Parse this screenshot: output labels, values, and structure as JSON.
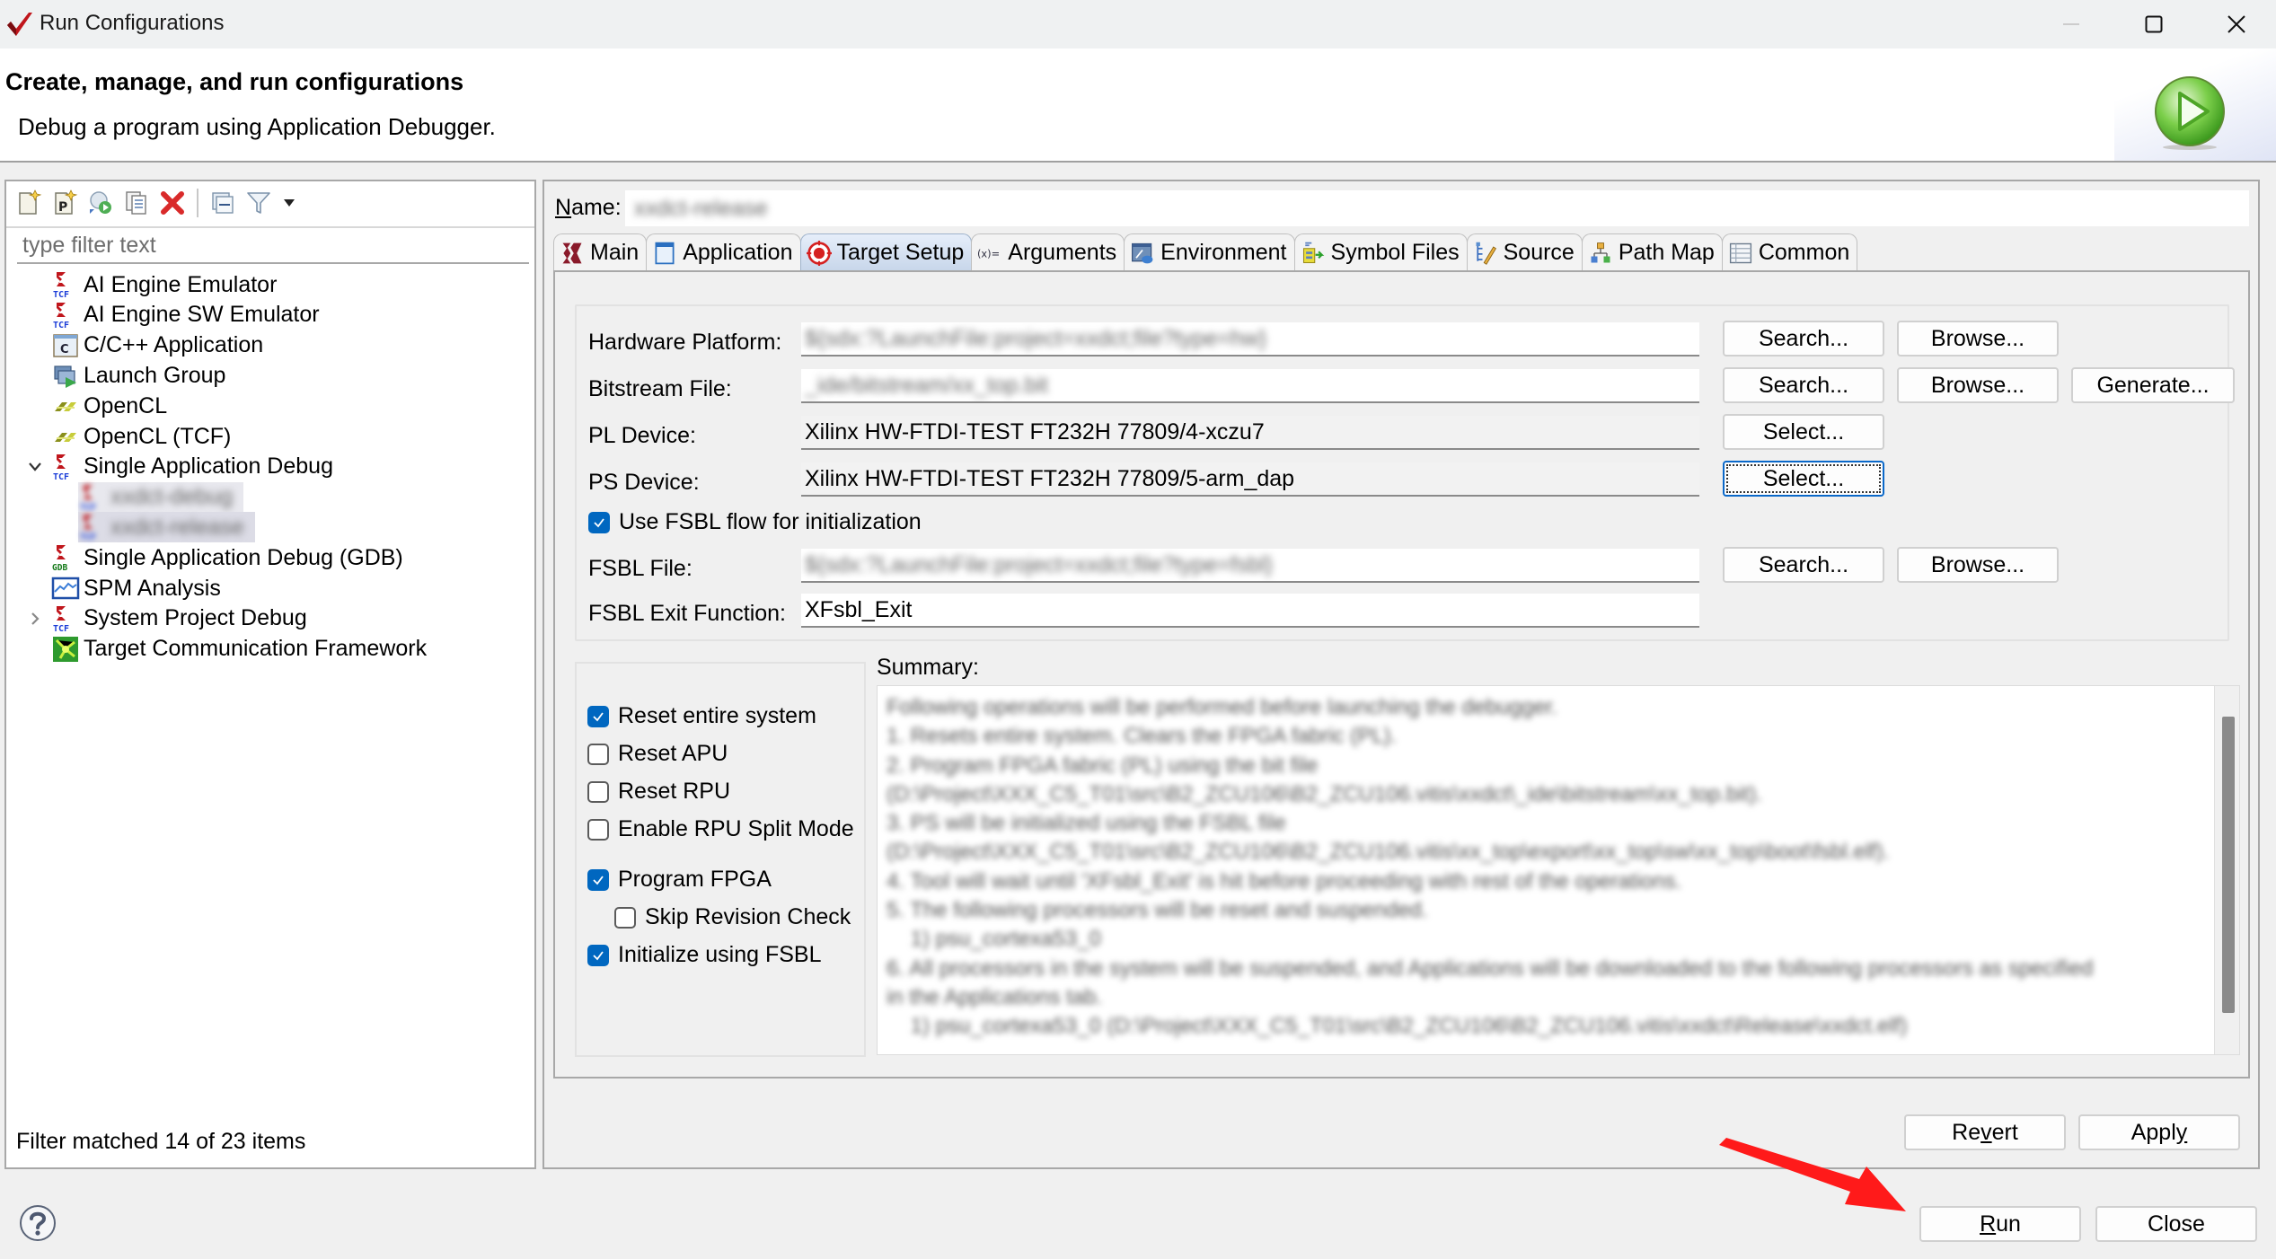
{
  "window": {
    "title": "Run Configurations",
    "controls": {
      "minimize": "minimize",
      "maximize": "maximize",
      "close": "close"
    }
  },
  "header": {
    "heading": "Create, manage, and run configurations",
    "description": "Debug a program using Application Debugger."
  },
  "left_panel": {
    "toolbar": [
      "new-configuration",
      "new-prototype",
      "export",
      "duplicate",
      "delete",
      "collapse-all",
      "filter",
      "view-menu"
    ],
    "filter_placeholder": "type filter text",
    "filter_value": "",
    "tree": [
      {
        "label": "AI Engine Emulator",
        "icon": "xilinx-tcf-icon",
        "expand": "none"
      },
      {
        "label": "AI Engine SW Emulator",
        "icon": "xilinx-tcf-icon",
        "expand": "none"
      },
      {
        "label": "C/C++ Application",
        "icon": "c-app-icon",
        "expand": "none"
      },
      {
        "label": "Launch Group",
        "icon": "launch-group-icon",
        "expand": "none"
      },
      {
        "label": "OpenCL",
        "icon": "opencl-icon",
        "expand": "none"
      },
      {
        "label": "OpenCL (TCF)",
        "icon": "opencl-icon",
        "expand": "none"
      },
      {
        "label": "Single Application Debug",
        "icon": "xilinx-tcf-icon",
        "expand": "expanded"
      },
      {
        "label": "xxdct-debug",
        "icon": "xilinx-tcf-icon",
        "expand": "child",
        "redacted": true
      },
      {
        "label": "xxdct-release",
        "icon": "xilinx-tcf-icon",
        "expand": "child",
        "redacted": true,
        "selected": true
      },
      {
        "label": "Single Application Debug (GDB)",
        "icon": "xilinx-gdb-icon",
        "expand": "none"
      },
      {
        "label": "SPM Analysis",
        "icon": "spm-icon",
        "expand": "none"
      },
      {
        "label": "System Project Debug",
        "icon": "xilinx-tcf-icon",
        "expand": "collapsed"
      },
      {
        "label": "Target Communication Framework",
        "icon": "tcf-icon",
        "expand": "none"
      }
    ],
    "status": "Filter matched 14 of 23 items"
  },
  "config": {
    "name_label": "Name:",
    "name_value": "xxdct-release",
    "tabs": [
      {
        "label": "Main",
        "icon": "xilinx-icon",
        "active": false
      },
      {
        "label": "Application",
        "icon": "application-icon",
        "active": false
      },
      {
        "label": "Target Setup",
        "icon": "target-icon",
        "active": true
      },
      {
        "label": "Arguments",
        "icon": "arguments-icon",
        "active": false
      },
      {
        "label": "Environment",
        "icon": "environment-icon",
        "active": false
      },
      {
        "label": "Symbol Files",
        "icon": "symbol-files-icon",
        "active": false
      },
      {
        "label": "Source",
        "icon": "source-icon",
        "active": false
      },
      {
        "label": "Path Map",
        "icon": "path-map-icon",
        "active": false
      },
      {
        "label": "Common",
        "icon": "common-icon",
        "active": false
      }
    ],
    "target_setup": {
      "hardware_platform": {
        "label": "Hardware Platform:",
        "value": "${sdx:?LaunchFile:project=xxdct;file?type=hw}",
        "redacted": true
      },
      "bitstream_file": {
        "label": "Bitstream File:",
        "value": "_ide/bitstream/xx_top.bit",
        "redacted": true
      },
      "pl_device": {
        "label": "PL Device:",
        "value": "Xilinx HW-FTDI-TEST FT232H 77809/4-xczu7"
      },
      "ps_device": {
        "label": "PS Device:",
        "value": "Xilinx HW-FTDI-TEST FT232H 77809/5-arm_dap"
      },
      "use_fsbl_flow": {
        "label": "Use FSBL flow for initialization",
        "checked": true
      },
      "fsbl_file": {
        "label": "FSBL File:",
        "value": "${sdx:?LaunchFile:project=xxdct;file?type=fsbl}",
        "redacted": true
      },
      "fsbl_exit_function": {
        "label": "FSBL Exit Function:",
        "value": "XFsbl_Exit"
      },
      "buttons": {
        "search": "Search...",
        "browse": "Browse...",
        "generate": "Generate...",
        "select": "Select..."
      }
    },
    "options": [
      {
        "label": "Reset entire system",
        "checked": true,
        "indent": false
      },
      {
        "label": "Reset APU",
        "checked": false,
        "indent": false
      },
      {
        "label": "Reset RPU",
        "checked": false,
        "indent": false
      },
      {
        "label": "Enable RPU Split Mode",
        "checked": false,
        "indent": false
      },
      {
        "label": "Program FPGA",
        "checked": true,
        "indent": false
      },
      {
        "label": "Skip Revision Check",
        "checked": false,
        "indent": true
      },
      {
        "label": "Initialize using FSBL",
        "checked": true,
        "indent": false
      }
    ],
    "summary_label": "Summary:",
    "summary_lines": [
      "Following operations will be performed before launching the debugger.",
      "1. Resets entire system. Clears the FPGA fabric (PL).",
      "2. Program FPGA fabric (PL) using the bit file",
      "(D:\\Project\\XXX_C5_T01\\src\\B2_ZCU106\\B2_ZCU106.vitis\\xxdct\\_ide\\bitstream\\xx_top.bit).",
      "3. PS will be initialized using the FSBL file",
      "(D:\\Project\\XXX_C5_T01\\src\\B2_ZCU106\\B2_ZCU106.vitis\\xx_top\\export\\xx_top\\sw\\xx_top\\boot\\fsbl.elf).",
      "4. Tool will wait until 'XFsbl_Exit' is hit before proceeding with rest of the operations.",
      "5. The following processors will be reset and suspended.",
      "    1) psu_cortexa53_0",
      "6. All processors in the system will be suspended, and Applications will be downloaded to the following processors as specified",
      "in the Applications tab.",
      "    1) psu_cortexa53_0 (D:\\Project\\XXX_C5_T01\\src\\B2_ZCU106\\B2_ZCU106.vitis\\xxdct\\Release\\xxdct.elf)"
    ],
    "revert": "Revert",
    "apply": "Apply"
  },
  "footer": {
    "help": "help",
    "run": "Run",
    "close": "Close"
  },
  "colors": {
    "accent": "#0067c0",
    "annotation_arrow": "#ff1a1a",
    "active_tab": "#c7d6ea"
  }
}
